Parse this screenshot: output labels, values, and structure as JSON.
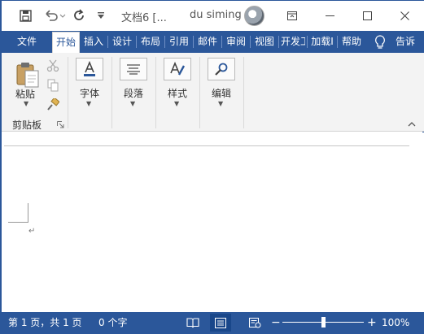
{
  "titlebar": {
    "doc_title": "文档6 [...",
    "user_name": "du siming",
    "icons": [
      "save-icon",
      "undo-icon",
      "redo-icon",
      "customize-icon",
      "avatar",
      "ribbon-display-icon",
      "minimize-icon",
      "maximize-icon",
      "close-icon"
    ]
  },
  "tabs": {
    "file": "文件",
    "items": [
      "开始",
      "插入",
      "设计",
      "布局",
      "引用",
      "邮件",
      "审阅",
      "视图",
      "开发工",
      "加载I",
      "帮助"
    ],
    "active": "开始",
    "tell_me": "告诉"
  },
  "ribbon": {
    "clipboard": {
      "paste": "粘贴",
      "group": "剪贴板"
    },
    "groups": [
      "字体",
      "段落",
      "样式",
      "编辑"
    ]
  },
  "status": {
    "page": "第 1 页，共 1 页",
    "words": "0 个字",
    "zoom": "100%",
    "zoom_percent": 100
  },
  "colors": {
    "accent": "#2b579a",
    "ribbon_bg": "#f3f3f3"
  }
}
